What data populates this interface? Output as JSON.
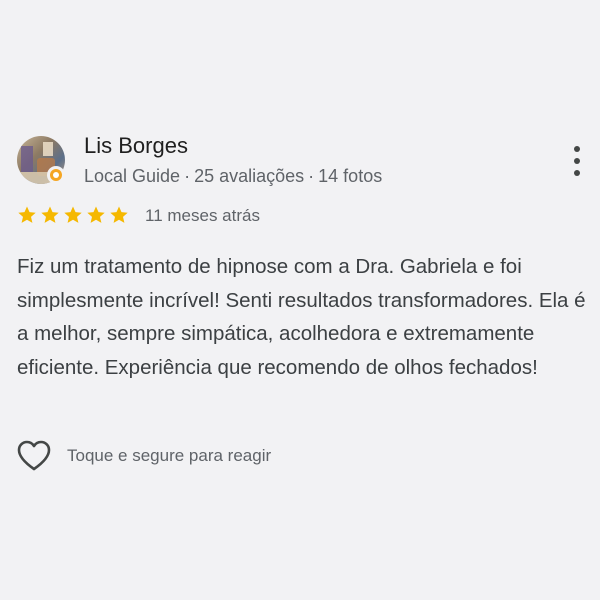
{
  "review": {
    "author": {
      "name": "Lis Borges",
      "badge_icon": "local-guide-badge-icon",
      "badge_color": "#f5a623",
      "meta": {
        "role": "Local Guide",
        "separator": "·",
        "reviews": "25 avaliações",
        "photos": "14 fotos"
      }
    },
    "rating": 5,
    "star_color": "#f5b800",
    "date": "11 meses atrás",
    "text": "Fiz um tratamento de hipnose com a Dra. Gabriela e foi simplesmente incrível! Senti resultados transformadores. Ela é a melhor, sempre simpática, acolhedora e extremamente eficiente. Experiência que recomendo de olhos fechados!",
    "reaction": {
      "icon": "heart-icon",
      "label": "Toque e segure para reagir"
    },
    "menu_icon": "more-vert-icon"
  }
}
